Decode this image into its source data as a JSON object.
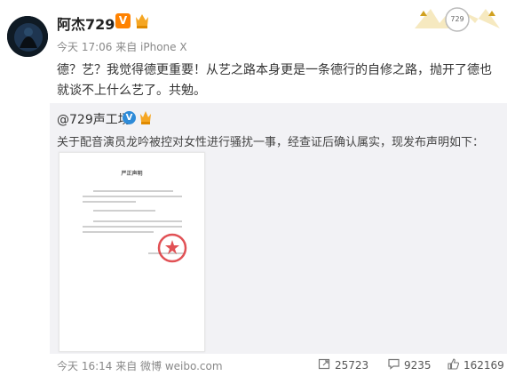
{
  "post": {
    "username": "阿杰729",
    "verified_badge": "V",
    "meta": "今天 17:06 来自 iPhone X",
    "text": "德？艺？我觉得德更重要！从艺之路本身更是一条德行的自修之路，抛开了德也就谈不上什么艺了。共勉。",
    "header_card_label": "729"
  },
  "repost": {
    "author": "@729声工场",
    "verified_badge": "V",
    "text": "关于配音演员龙吟被控对女性进行骚扰一事，经查证后确认属实，现发布声明如下：",
    "document": {
      "title": "严正声明"
    }
  },
  "footer": {
    "time_source": "今天 16:14 来自 微博 weibo.com",
    "reposts": "25723",
    "comments": "9235",
    "likes": "162169"
  },
  "icons": {
    "repost": "repost-icon",
    "comment": "comment-icon",
    "like": "like-icon"
  },
  "colors": {
    "accent_orange": "#ff8200",
    "verified_blue": "#2e8bd8",
    "repost_bg": "#f2f2f5"
  }
}
